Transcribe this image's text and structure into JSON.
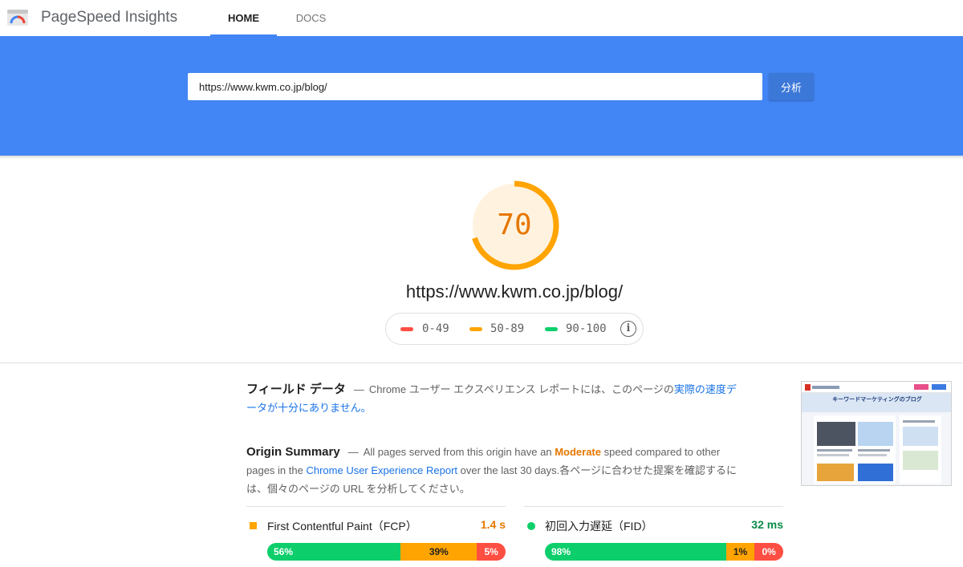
{
  "app": {
    "title": "PageSpeed Insights",
    "logo_icon": "pagespeed-gauge-icon"
  },
  "nav": {
    "tabs": [
      {
        "label": "HOME",
        "active": true
      },
      {
        "label": "DOCS",
        "active": false
      }
    ]
  },
  "search": {
    "value": "https://www.kwm.co.jp/blog/",
    "button_label": "分析"
  },
  "score": {
    "value": "70",
    "url": "https://www.kwm.co.jp/blog/",
    "legend": [
      {
        "range": "0-49",
        "color": "#ff4e42"
      },
      {
        "range": "50-89",
        "color": "#ffa400"
      },
      {
        "range": "90-100",
        "color": "#0cce6b"
      }
    ],
    "info_icon": "info-icon",
    "gauge_fraction": 0.7,
    "gauge_color": "#ffa400"
  },
  "field_data": {
    "heading": "フィールド データ",
    "desc_prefix": "Chrome ユーザー エクスペリエンス レポートには、このページの",
    "desc_link": "実際の速度データが十分にありません。"
  },
  "origin_summary": {
    "heading": "Origin Summary",
    "text_1": "All pages served from this origin have an",
    "rating": "Moderate",
    "text_2": "speed compared to other pages in the",
    "report_link": "Chrome User Experience Report",
    "text_3": "over the last 30 days.各ページに合わせた提案を確認するには、個々のページの URL を分析してください。"
  },
  "metrics": [
    {
      "name": "First Contentful Paint（FCP）",
      "value": "1.4 s",
      "rating": "average",
      "distribution": {
        "fast": "56%",
        "average": "39%",
        "slow": "5%"
      }
    },
    {
      "name": "初回入力遅延（FID）",
      "value": "32 ms",
      "rating": "fast",
      "distribution": {
        "fast": "98%",
        "average": "1%",
        "slow": "0%"
      }
    }
  ],
  "thumbnail": {
    "heading": "キーワードマーケティングのブログ"
  },
  "colors": {
    "brand_blue": "#4285f4",
    "fast": "#0cce6b",
    "average": "#ffa400",
    "slow": "#ff4e42"
  }
}
